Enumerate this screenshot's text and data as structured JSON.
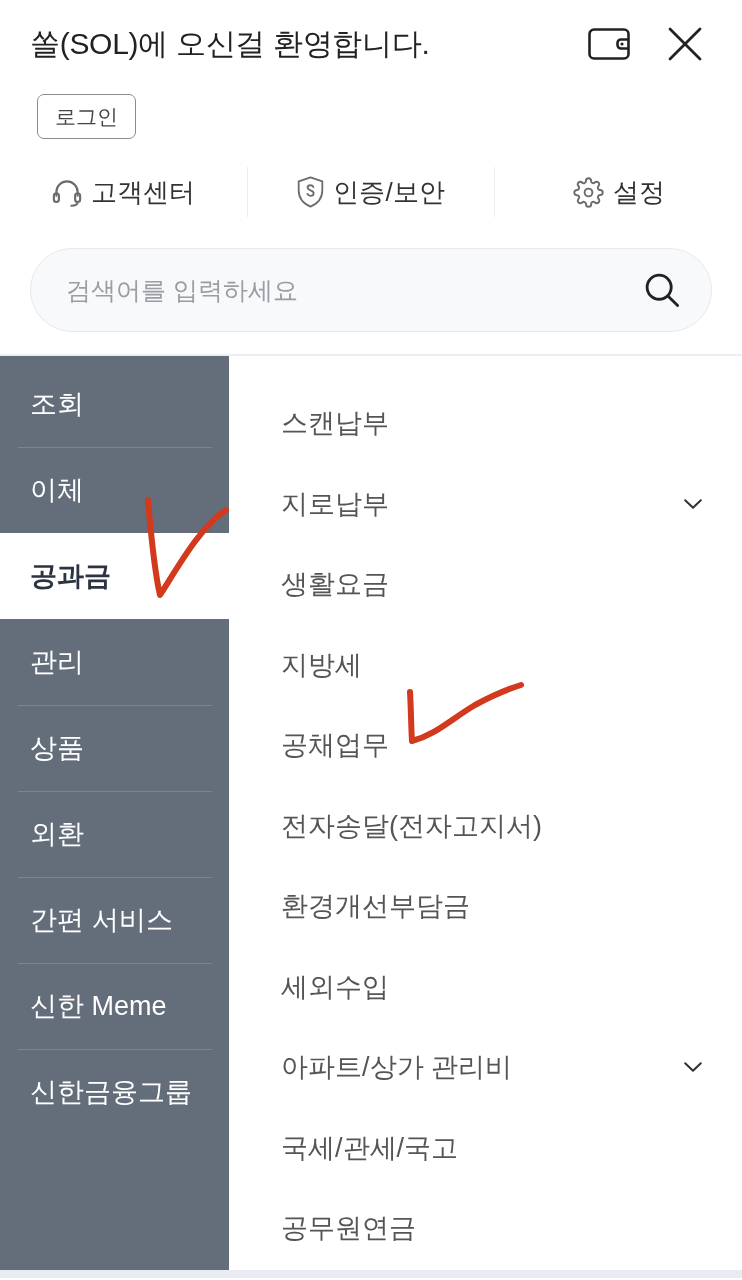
{
  "header": {
    "title": "쏠(SOL)에 오신걸 환영합니다.",
    "login_button": "로그인"
  },
  "quick_links": [
    {
      "kind": "support",
      "label": "고객센터"
    },
    {
      "kind": "security",
      "label": "인증/보안"
    },
    {
      "kind": "settings",
      "label": "설정"
    }
  ],
  "search": {
    "placeholder": "검색어를 입력하세요"
  },
  "categories": [
    {
      "label": "조회",
      "selected": false,
      "marked": false
    },
    {
      "label": "이체",
      "selected": false,
      "marked": false
    },
    {
      "label": "공과금",
      "selected": true,
      "marked": true
    },
    {
      "label": "관리",
      "selected": false,
      "marked": false
    },
    {
      "label": "상품",
      "selected": false,
      "marked": false
    },
    {
      "label": "외환",
      "selected": false,
      "marked": false
    },
    {
      "label": "간편 서비스",
      "selected": false,
      "marked": false
    },
    {
      "label": "신한 Meme",
      "selected": false,
      "marked": false
    },
    {
      "label": "신한금융그룹",
      "selected": false,
      "marked": false
    }
  ],
  "submenu": [
    {
      "label": "스캔납부",
      "kind": "link",
      "marked": false
    },
    {
      "label": "지로납부",
      "kind": "expandable",
      "marked": false
    },
    {
      "label": "생활요금",
      "kind": "link",
      "marked": false
    },
    {
      "label": "지방세",
      "kind": "link",
      "marked": false
    },
    {
      "label": "공채업무",
      "kind": "link",
      "marked": true
    },
    {
      "label": "전자송달(전자고지서)",
      "kind": "link",
      "marked": false
    },
    {
      "label": "환경개선부담금",
      "kind": "link",
      "marked": false
    },
    {
      "label": "세외수입",
      "kind": "link",
      "marked": false
    },
    {
      "label": "아파트/상가 관리비",
      "kind": "expandable",
      "marked": false
    },
    {
      "label": "국세/관세/국고",
      "kind": "link",
      "marked": false
    },
    {
      "label": "공무원연금",
      "kind": "link",
      "marked": false
    }
  ]
}
